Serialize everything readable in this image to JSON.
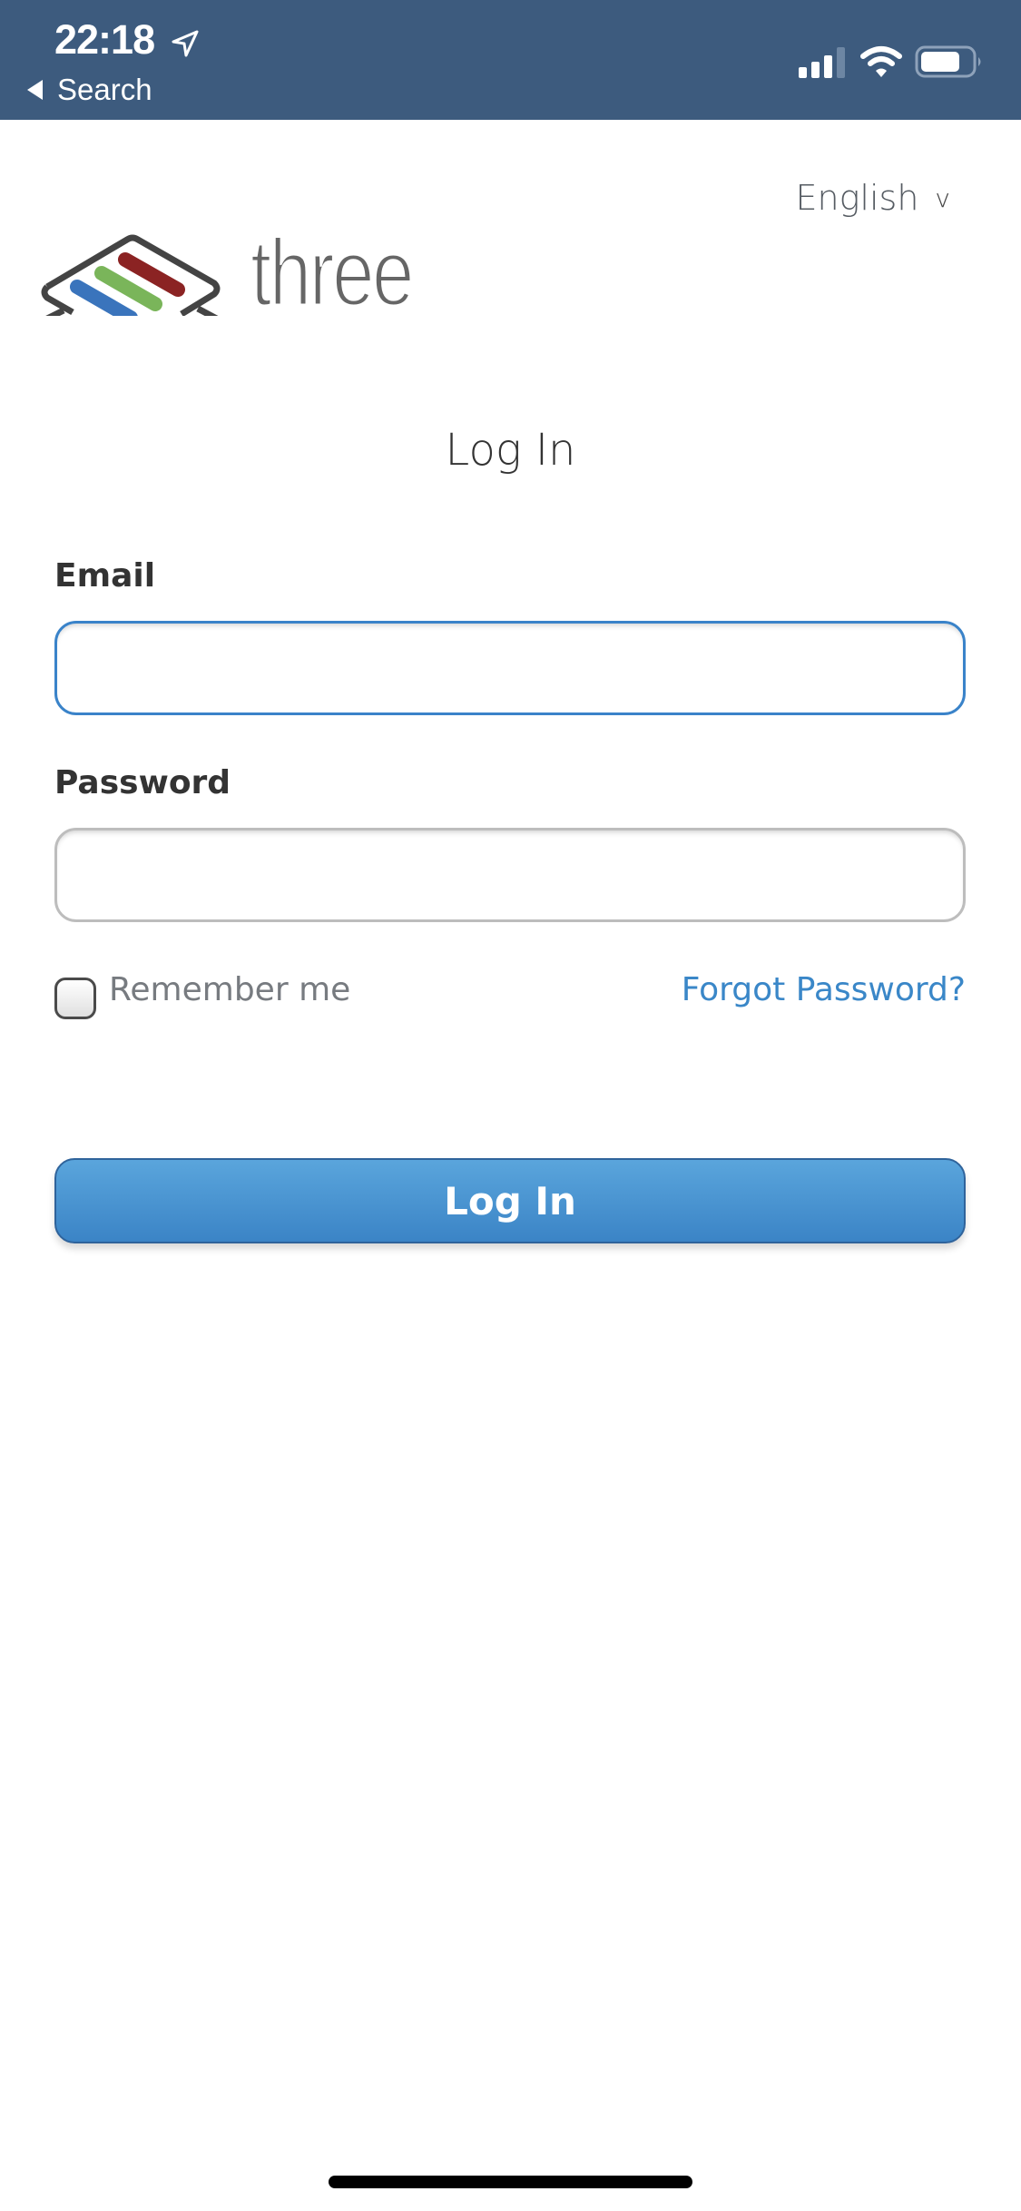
{
  "status_bar": {
    "time": "22:18",
    "location_icon": "location-arrow-icon",
    "back_label": "Search",
    "signal_icon": "cellular-signal-icon",
    "wifi_icon": "wifi-icon",
    "battery_icon": "battery-icon",
    "background_color": "#3d5b7e"
  },
  "header": {
    "language_label": "English",
    "language_chevron": "v",
    "brand_name": "three",
    "logo_colors": [
      "#3a74bc",
      "#7ab55a",
      "#8b2323"
    ]
  },
  "form": {
    "title": "Log In",
    "email_label": "Email",
    "email_value": "",
    "email_placeholder": "",
    "password_label": "Password",
    "password_value": "",
    "password_placeholder": "",
    "remember_label": "Remember me",
    "remember_checked": false,
    "forgot_label": "Forgot Password?",
    "submit_label": "Log In",
    "accent_color": "#3a87c8"
  }
}
